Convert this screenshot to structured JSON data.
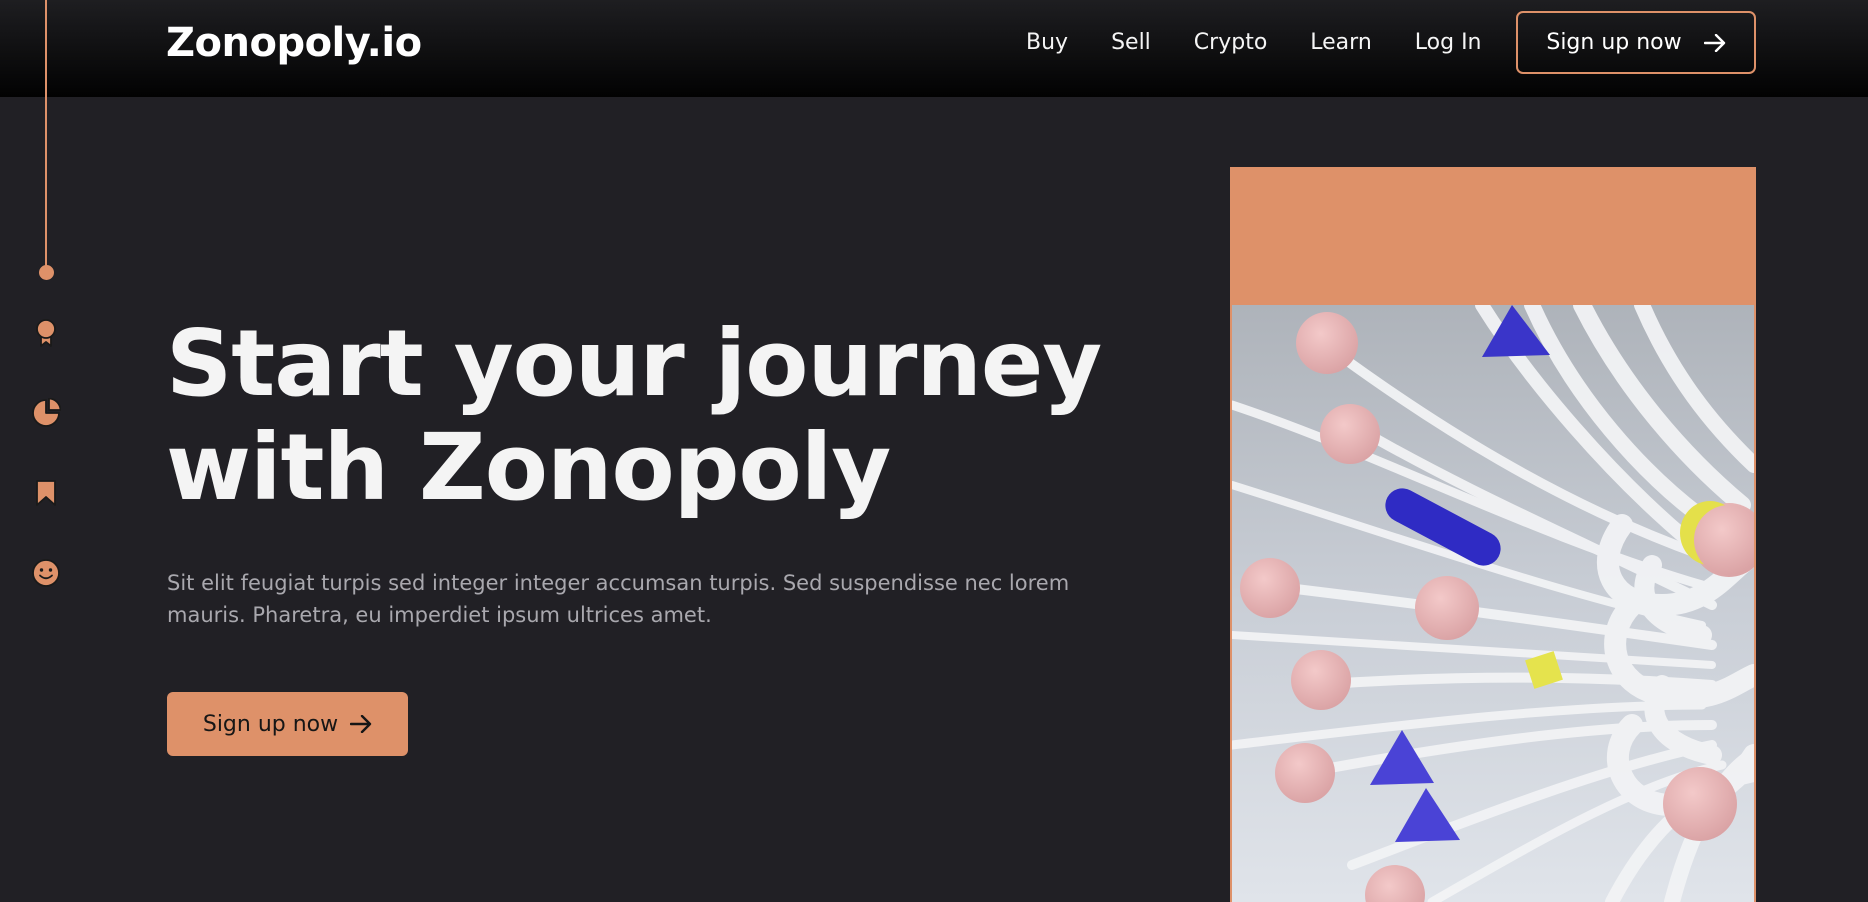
{
  "brand": {
    "logo_text": "Zonopoly.io",
    "accent_color": "#de9169"
  },
  "nav": {
    "links": [
      "Buy",
      "Sell",
      "Crypto",
      "Learn",
      "Log In"
    ],
    "cta_label": "Sign up now",
    "cta_icon": "arrow-right-icon"
  },
  "sidebar": {
    "icons": [
      "award-icon",
      "pie-chart-icon",
      "bookmark-icon",
      "smile-icon"
    ]
  },
  "hero": {
    "title_line1": "Start your journey",
    "title_line2": "with Zonopoly",
    "description": "Sit elit feugiat turpis sed integer integer accumsan turpis. Sed suspendisse nec lorem mauris. Pharetra, eu imperdiet ipsum ultrices amet.",
    "cta_label": "Sign up now",
    "cta_icon": "arrow-right-icon"
  },
  "artwork": {
    "description_icon": "abstract-3d-artwork"
  }
}
